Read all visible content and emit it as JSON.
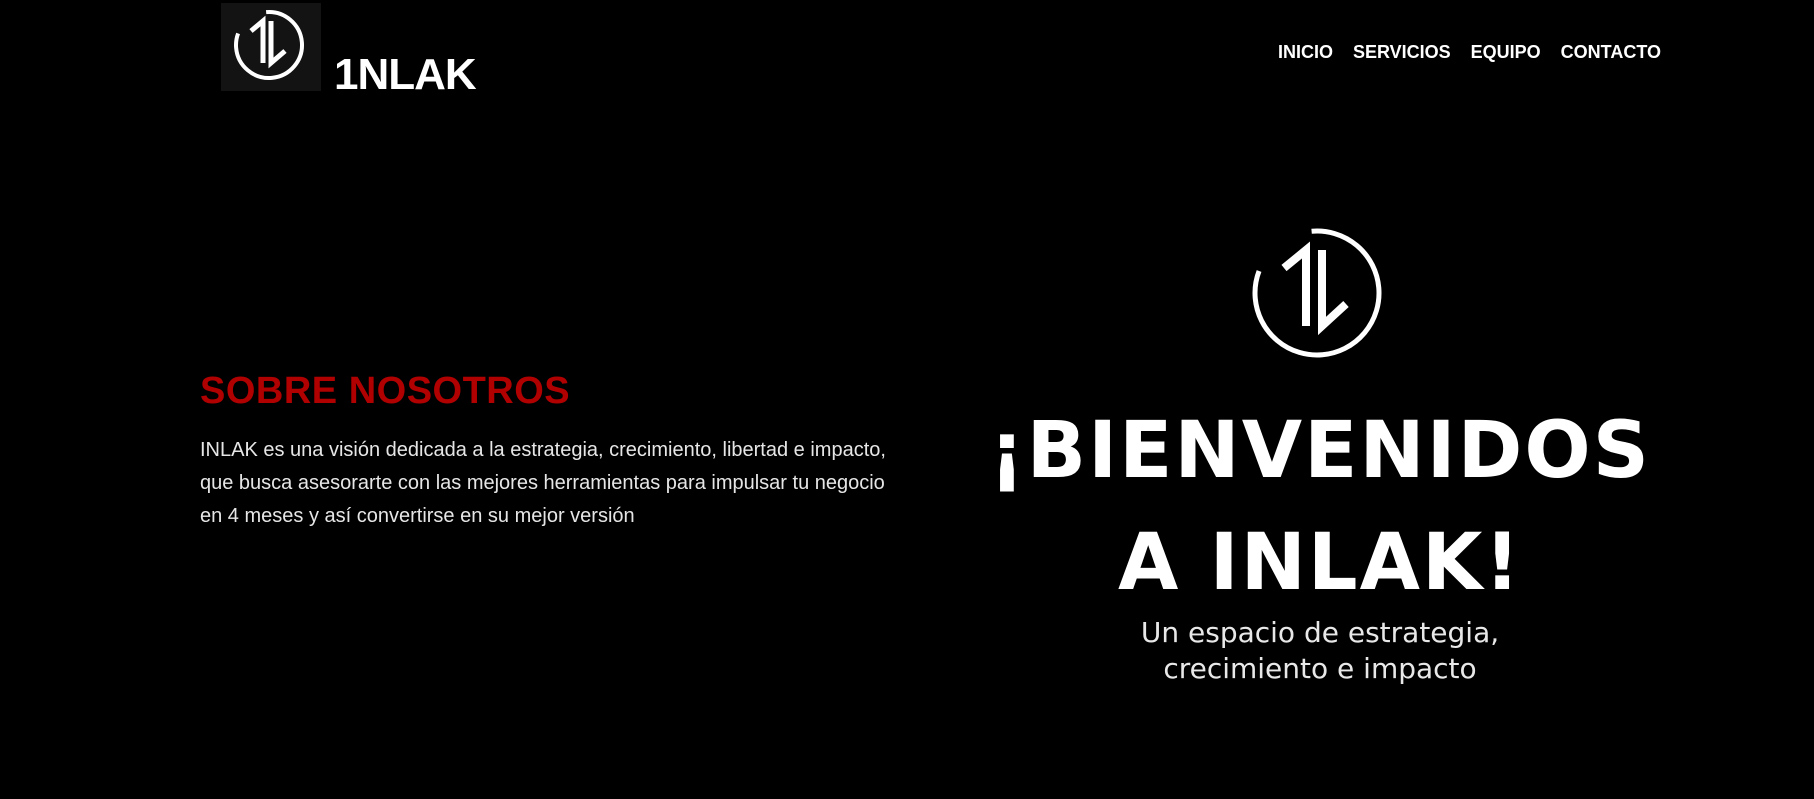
{
  "header": {
    "brand_name": "1NLAK",
    "logo_icon": "inlak-monogram-icon",
    "nav": [
      {
        "label": "INICIO"
      },
      {
        "label": "SERVICIOS"
      },
      {
        "label": "EQUIPO"
      },
      {
        "label": "CONTACTO"
      }
    ]
  },
  "about": {
    "title": "SOBRE NOSOTROS",
    "text": "INLAK es una visión dedicada a la estrategia, crecimiento, libertad e impacto, que busca asesorarte con las mejores herramientas para impulsar tu negocio en 4 meses y así convertirse en su mejor versión"
  },
  "hero": {
    "logo_icon": "inlak-monogram-icon",
    "title_line1": "¡BIENVENIDOS",
    "title_line2": "A INLAK!",
    "subtitle_line1": "Un espacio de estrategia,",
    "subtitle_line2": "crecimiento e impacto"
  },
  "colors": {
    "background": "#000000",
    "accent": "#b00000",
    "text": "#ffffff"
  }
}
